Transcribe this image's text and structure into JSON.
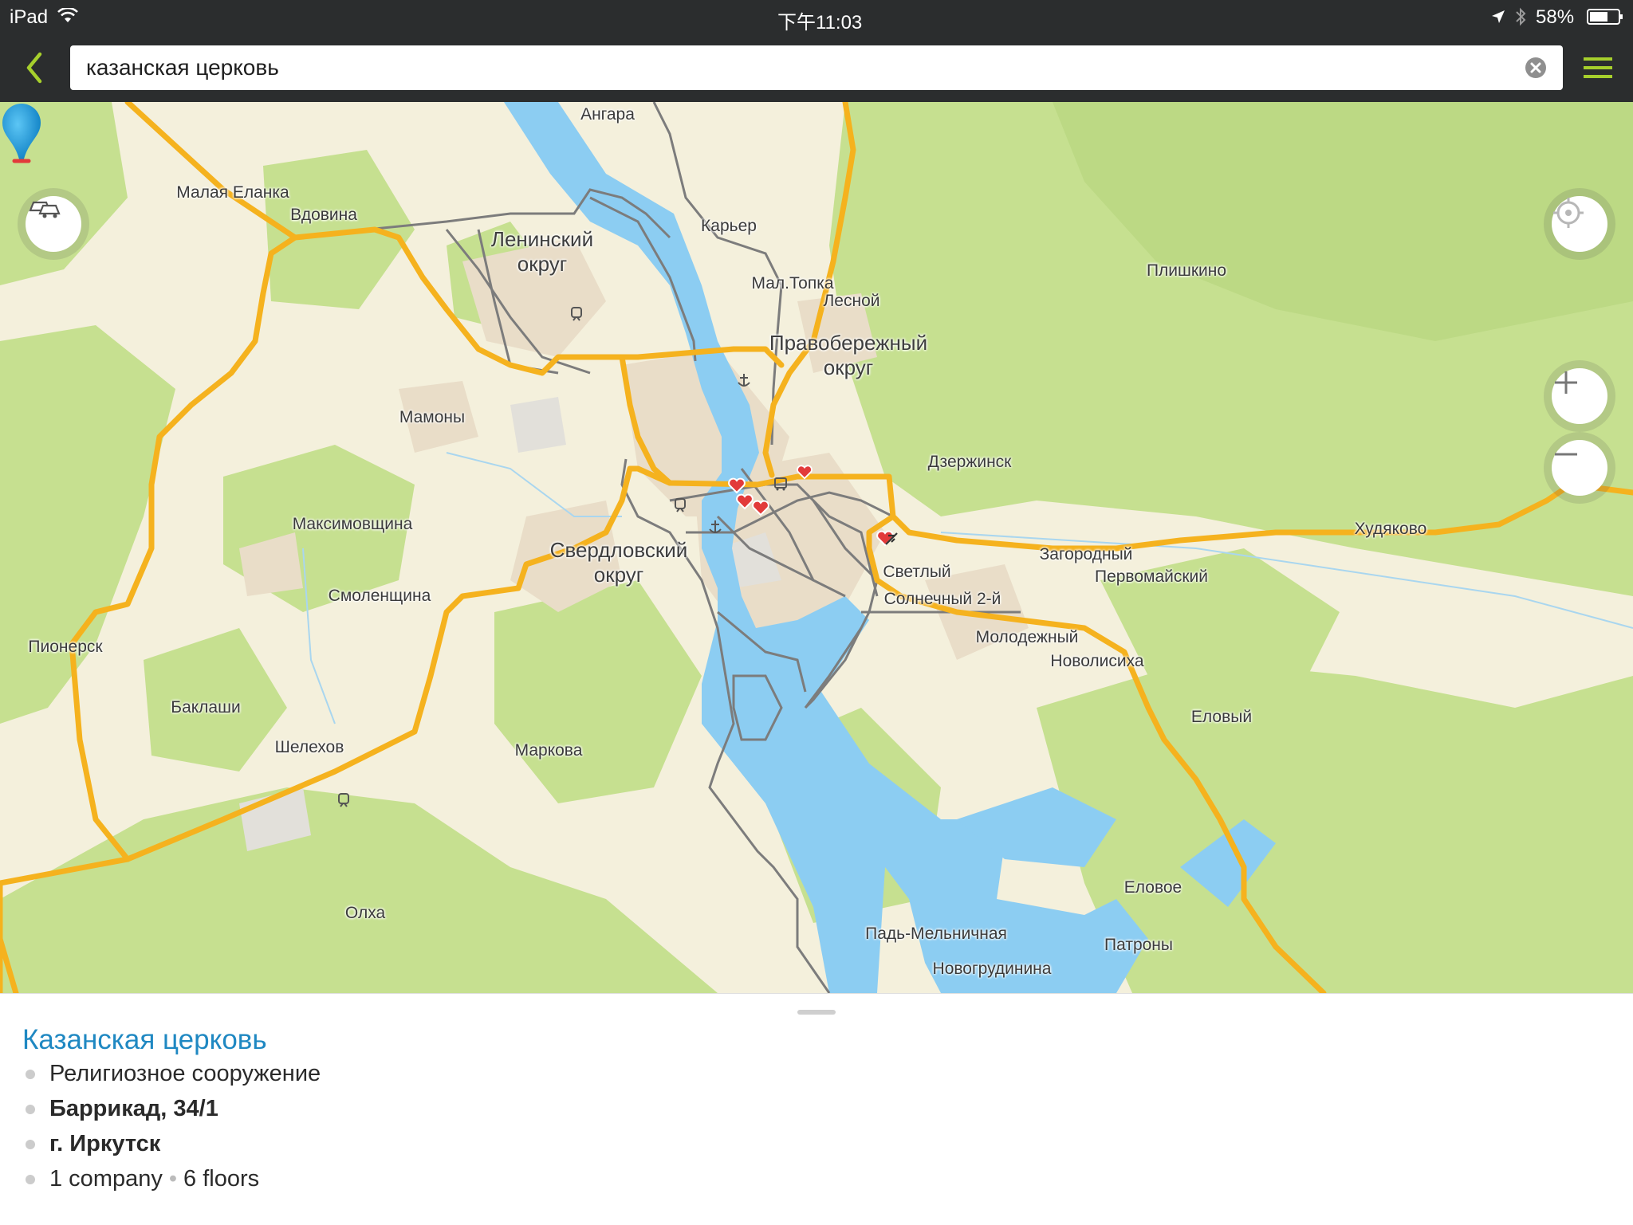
{
  "status_bar": {
    "device": "iPad",
    "time": "下午11:03",
    "battery": "58%"
  },
  "search": {
    "query": "казанская церковь"
  },
  "map": {
    "labels": {
      "angara": "Ангара",
      "malaya_elanka": "Малая Еланка",
      "vdovina": "Вдовина",
      "leninsky_1": "Ленинский",
      "leninsky_2": "округ",
      "karyer": "Карьер",
      "mal_topka": "Мал.Топка",
      "lesnoy": "Лесной",
      "pravoberezhny_1": "Правобережный",
      "pravoberezhny_2": "округ",
      "plishkino": "Плишкино",
      "mamony": "Мамоны",
      "dzerzhinsk": "Дзержинск",
      "maksimovshchina": "Максимовщина",
      "sverdlovsky_1": "Свердловский",
      "sverdlovsky_2": "округ",
      "zagorodny": "Загородный",
      "khudyakovo": "Худяково",
      "svetly": "Светлый",
      "pervomaysky": "Первомайский",
      "solnechny": "Солнечный 2-й",
      "smolenshchina": "Смоленщина",
      "molodezhny": "Молодежный",
      "novolisikha": "Новолисиха",
      "pionersk": "Пионерск",
      "baklashi": "Баклаши",
      "elovy": "Еловый",
      "shelekhov": "Шелехов",
      "markova": "Маркова",
      "elovoe": "Еловое",
      "olkha": "Олха",
      "pad_melnichnaya": "Падь-Мельничная",
      "patrony": "Патроны",
      "novogrudinina": "Новогрудинина"
    }
  },
  "place": {
    "title": "Казанская церковь",
    "category": "Религиозное сооружение",
    "address": "Баррикад, 34/1",
    "city": "г. Иркутск",
    "companies": "1 company",
    "floors": "6 floors"
  },
  "colors": {
    "bars": "#2b2d2e",
    "accent": "#a6cf2c",
    "water": "#8ccdf2",
    "forest": "#c6e090",
    "land": "#f4f0dc",
    "road": "#f5b21e",
    "link": "#1f88c2"
  }
}
